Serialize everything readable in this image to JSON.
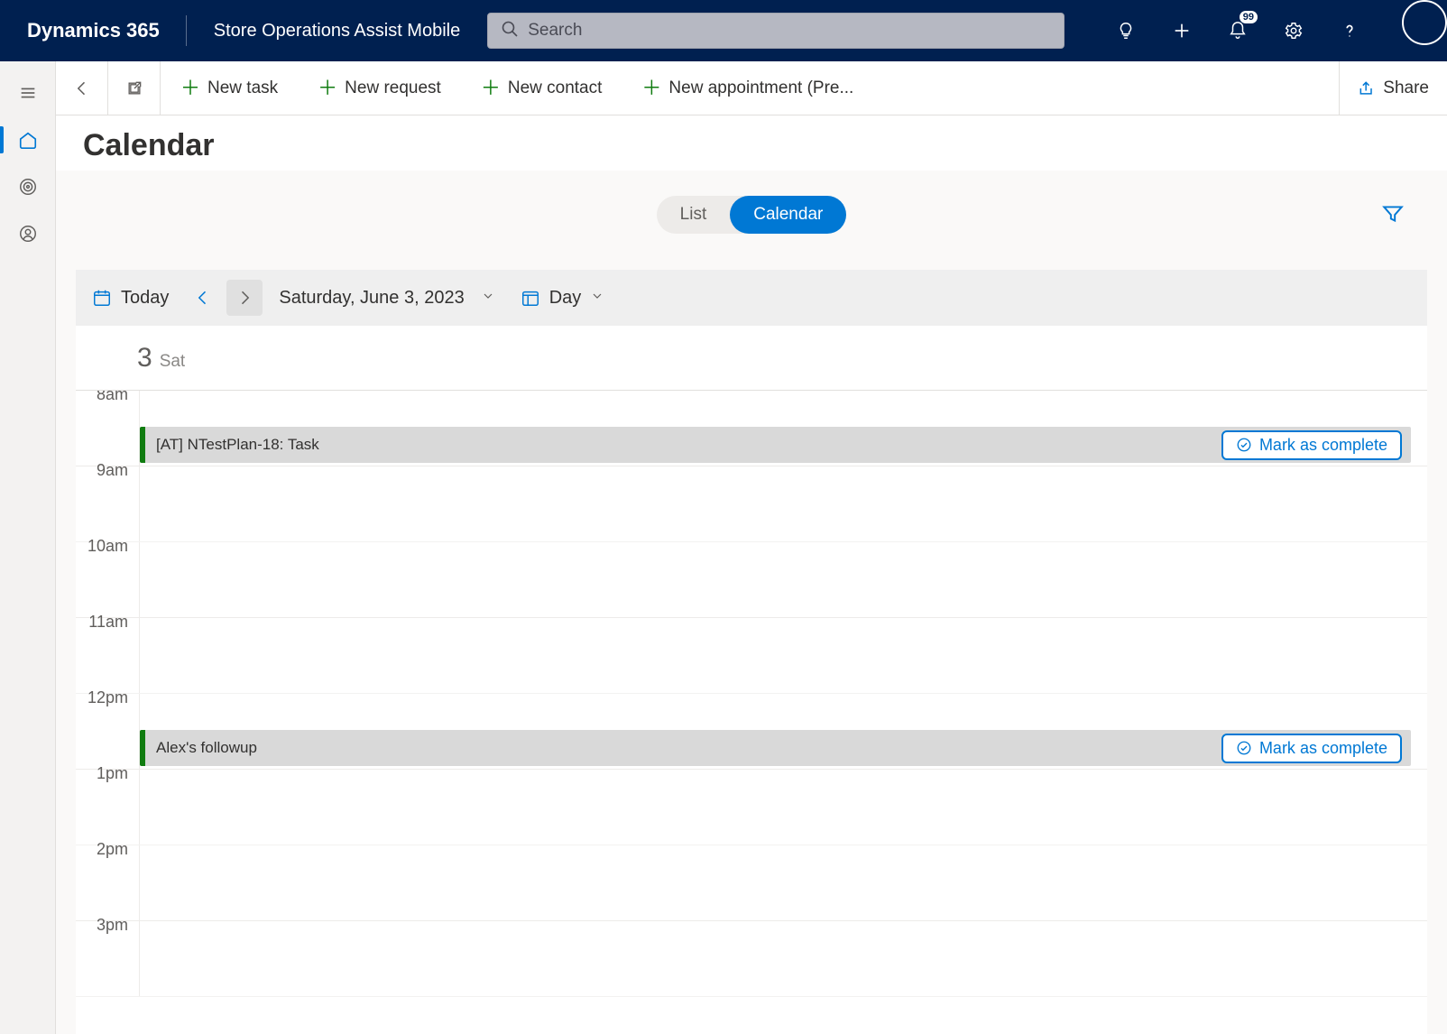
{
  "top": {
    "brand": "Dynamics 365",
    "app_name": "Store Operations Assist Mobile",
    "search_placeholder": "Search",
    "notification_count": "99"
  },
  "cmd": {
    "new_task": "New task",
    "new_request": "New request",
    "new_contact": "New contact",
    "new_appointment": "New appointment (Pre...",
    "share": "Share"
  },
  "page": {
    "title": "Calendar"
  },
  "toggle": {
    "list": "List",
    "calendar": "Calendar",
    "active": "calendar"
  },
  "caltb": {
    "today": "Today",
    "date": "Saturday, June 3, 2023",
    "view": "Day"
  },
  "calhdr": {
    "num": "3",
    "dow": "Sat"
  },
  "hours": [
    "8am",
    "9am",
    "10am",
    "11am",
    "12pm",
    "1pm",
    "2pm",
    "3pm"
  ],
  "events": [
    {
      "time_index": 1,
      "label": "[AT] NTestPlan-18: Task",
      "complete_label": "Mark as complete"
    },
    {
      "time_index": 5,
      "label": "Alex's followup",
      "complete_label": "Mark as complete"
    }
  ]
}
